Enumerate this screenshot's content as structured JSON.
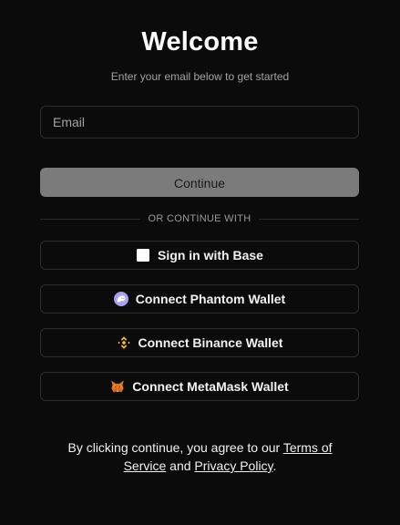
{
  "header": {
    "title": "Welcome",
    "subtitle": "Enter your email below to get started"
  },
  "email": {
    "placeholder": "Email",
    "value": ""
  },
  "continue_label": "Continue",
  "divider_label": "OR CONTINUE WITH",
  "providers": [
    {
      "label": "Sign in with Base",
      "icon": "base-square-icon",
      "color": "#ffffff"
    },
    {
      "label": "Connect Phantom Wallet",
      "icon": "phantom-icon",
      "color": "#ab9ff2"
    },
    {
      "label": "Connect Binance Wallet",
      "icon": "binance-icon",
      "color": "#f3ba2f"
    },
    {
      "label": "Connect MetaMask Wallet",
      "icon": "metamask-icon",
      "color": "#e2761b"
    }
  ],
  "footer": {
    "prefix": "By clicking continue, you agree to our ",
    "terms_link": "Terms of Service",
    "middle": " and ",
    "privacy_link": "Privacy Policy",
    "suffix": "."
  },
  "colors": {
    "background": "#0b0b0c",
    "continue_button": "#7b7b7b",
    "border": "#2c2c30"
  }
}
